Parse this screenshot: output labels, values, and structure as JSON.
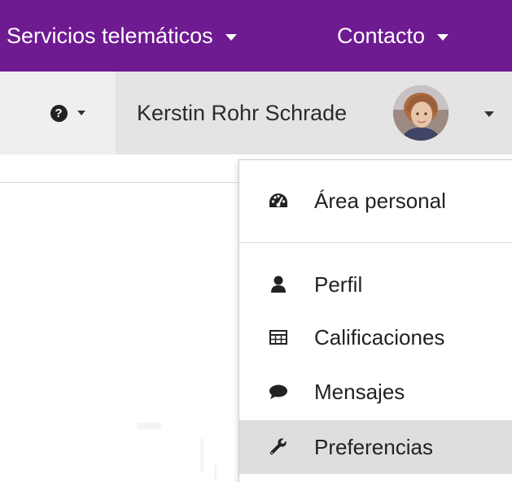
{
  "topnav": {
    "services_label": "Servicios telemáticos",
    "contact_label": "Contacto"
  },
  "userbar": {
    "help_icon_glyph": "?",
    "user_name": "Kerstin Rohr Schrade"
  },
  "dropdown": {
    "items": [
      {
        "label": "Área personal",
        "icon": "dashboard-icon"
      },
      {
        "label": "Perfil",
        "icon": "user-icon"
      },
      {
        "label": "Calificaciones",
        "icon": "table-icon"
      },
      {
        "label": "Mensajes",
        "icon": "comment-icon"
      },
      {
        "label": "Preferencias",
        "icon": "wrench-icon"
      }
    ],
    "active_item": "Preferencias"
  },
  "colors": {
    "nav_background": "#6e1a91",
    "userbar_background": "#e4e4e4",
    "help_background": "#efefef",
    "active_item_background": "#dedede",
    "text": "#222222"
  }
}
